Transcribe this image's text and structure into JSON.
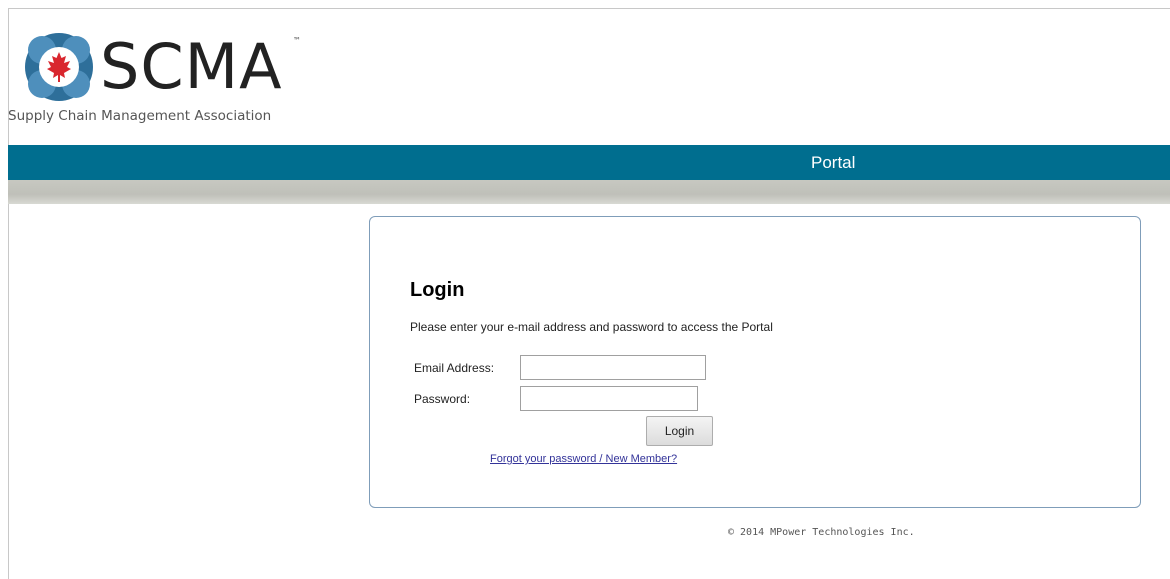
{
  "brand": {
    "logo_text": "SCMA",
    "trademark": "™",
    "subtitle": "Supply Chain Management Association",
    "colors": {
      "primary": "#006e8f",
      "maple_leaf": "#d9262e",
      "icon_blue": "#2e6f9a"
    }
  },
  "nav": {
    "portal_label": "Portal"
  },
  "login": {
    "title": "Login",
    "instruction": "Please enter your e-mail address and password to access the Portal",
    "email_label": "Email Address:",
    "email_value": "",
    "password_label": "Password:",
    "password_value": "",
    "button_label": "Login",
    "forgot_link": "Forgot your password / New Member?"
  },
  "footer": {
    "copyright": "© 2014 MPower Technologies Inc."
  }
}
